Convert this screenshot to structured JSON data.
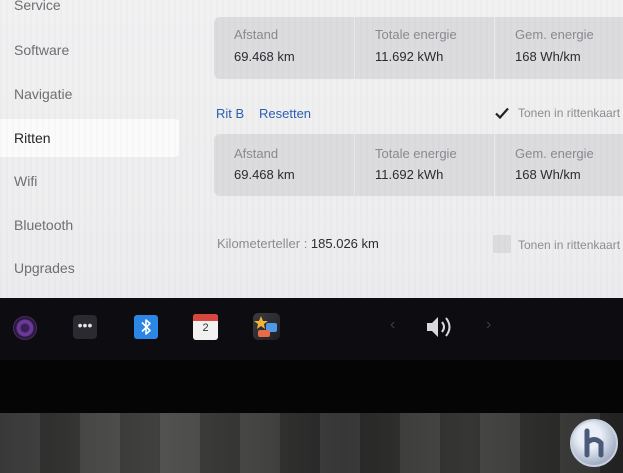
{
  "sidebar": {
    "items": [
      {
        "label": "Service"
      },
      {
        "label": "Software"
      },
      {
        "label": "Navigatie"
      },
      {
        "label": "Ritten",
        "active": true
      },
      {
        "label": "Wifi"
      },
      {
        "label": "Bluetooth"
      },
      {
        "label": "Upgrades"
      }
    ]
  },
  "trip_a": {
    "stats": [
      {
        "label": "Afstand",
        "value": "69.468 km"
      },
      {
        "label": "Totale energie",
        "value": "11.692 kWh"
      },
      {
        "label": "Gem. energie",
        "value": "168 Wh/km"
      }
    ]
  },
  "trip_b": {
    "title": "Rit B",
    "reset_label": "Resetten",
    "show_in_trip_card_label": "Tonen in rittenkaart",
    "show_in_trip_card_checked": true,
    "stats": [
      {
        "label": "Afstand",
        "value": "69.468 km"
      },
      {
        "label": "Totale energie",
        "value": "11.692 kWh"
      },
      {
        "label": "Gem. energie",
        "value": "168 Wh/km"
      }
    ]
  },
  "odometer": {
    "label": "Kilometerteller : ",
    "value": "185.026 km",
    "show_in_trip_card_label": "Tonen in rittenkaart",
    "show_in_trip_card_checked": false
  },
  "taskbar": {
    "more_label": "•••",
    "calendar_day": "2",
    "prev_glyph": "‹",
    "next_glyph": "›",
    "bluetooth_color": "#2c86e5",
    "calendar_header_color": "#d8473f"
  },
  "accent_color": "#2b5fb4"
}
